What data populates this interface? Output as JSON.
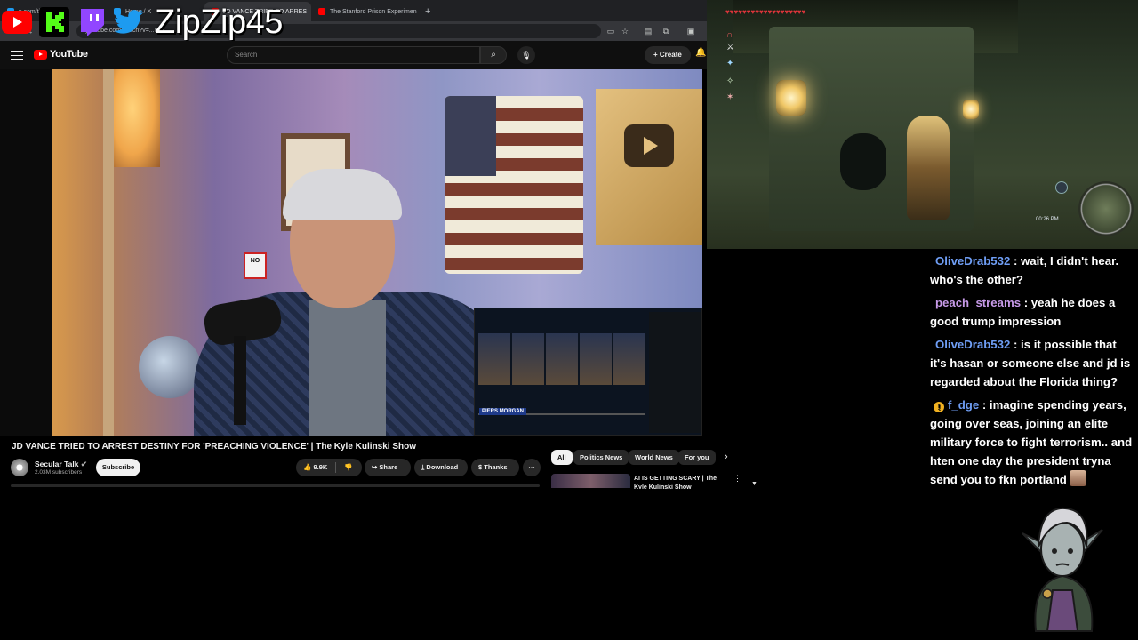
{
  "browser": {
    "tabs": [
      {
        "label": "x.com/thel...",
        "color": "#1d9bf0"
      },
      {
        "label": "Home / X",
        "color": "#1d9bf0"
      },
      {
        "label": "JD VANCE TRIED TO ARRES",
        "color": "#ff0000",
        "active": true
      },
      {
        "label": "The Stanford Prison Experimen",
        "color": "#ff0000"
      }
    ],
    "new_tab": "+",
    "url": "youtube.com/watch?v=...8fG"
  },
  "overlay": {
    "handle": "ZipZip45",
    "icons": [
      "youtube-icon",
      "kick-icon",
      "twitch-icon",
      "twitter-icon"
    ],
    "colors": {
      "youtube": "#ff0000",
      "kick": "#53fc18",
      "twitch": "#9146ff",
      "twitter": "#1d9bf0"
    }
  },
  "youtube": {
    "logo_text": "YouTube",
    "search_placeholder": "Search",
    "create_label": "Create",
    "video": {
      "title": "JD VANCE TRIED TO ARREST DESTINY FOR 'PREACHING VIOLENCE' | The Kyle Kulinski Show",
      "sign_text": "NO",
      "pip_label": "PIERS MORGAN"
    },
    "channel": {
      "name": "Secular Talk",
      "subscribers": "2.03M subscribers",
      "subscribe_label": "Subscribe"
    },
    "actions": {
      "likes": "9.9K",
      "share": "Share",
      "download": "Download",
      "thanks": "Thanks",
      "more": "⋯"
    },
    "chips": [
      "All",
      "Politics News",
      "World News",
      "For you"
    ],
    "recommendation": {
      "title": "AI IS GETTING SCARY | The Kyle Kulinski Show"
    }
  },
  "game": {
    "hearts": "♥♥♥♥♥♥♥♥♥♥♥♥♥♥♥♥♥♥♥",
    "time": "00:26 PM"
  },
  "chat": [
    {
      "user": "OliveDrab532",
      "color": "#6f9ef5",
      "text": "wait, I didn't hear. who's the other?"
    },
    {
      "user": "peach_streams",
      "color": "#c79ae8",
      "text": "yeah he does a good trump impression"
    },
    {
      "user": "OliveDrab532",
      "color": "#6f9ef5",
      "text": "is it possible that it's hasan or someone else and jd is regarded about the Florida thing?"
    },
    {
      "user": "f_dge",
      "color": "#6f9ef5",
      "badge": "!",
      "text": "imagine spending years, going over seas, joining an elite military force to fight terrorism.. and hten one day the president tryna send you to fkn portland"
    }
  ]
}
